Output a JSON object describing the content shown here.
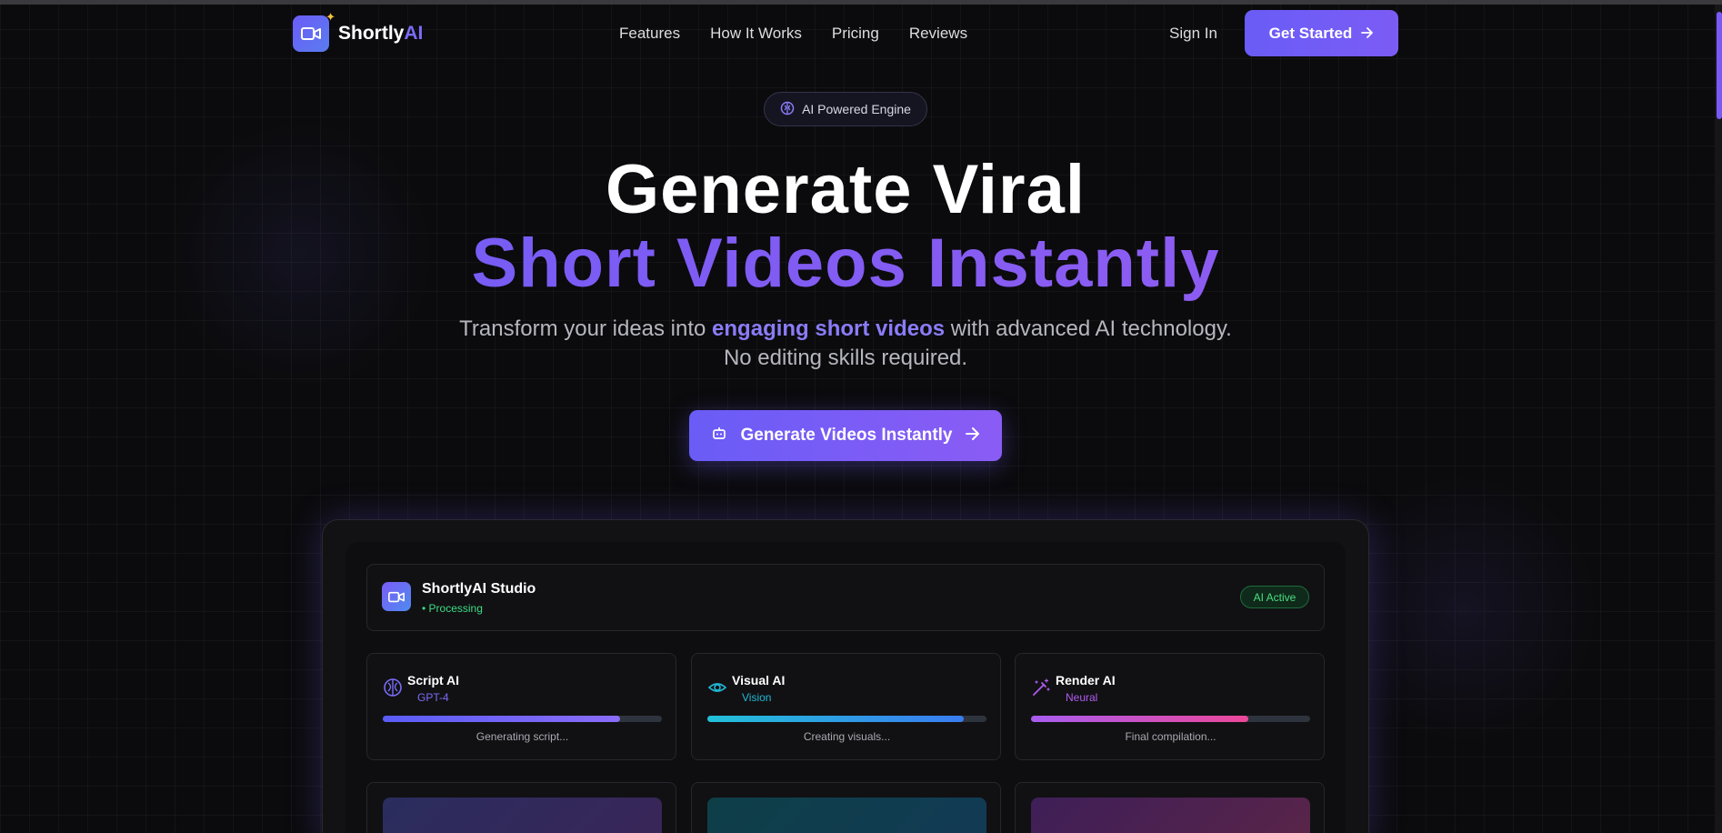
{
  "brand": {
    "name_main": "Shortly",
    "name_accent": "AI"
  },
  "nav": {
    "links": [
      "Features",
      "How It Works",
      "Pricing",
      "Reviews"
    ],
    "signin": "Sign In",
    "get_started": "Get Started"
  },
  "hero": {
    "badge": "AI Powered Engine",
    "title_line1": "Generate Viral",
    "title_line2": "Short Videos Instantly",
    "subtitle_pre": "Transform your ideas into",
    "subtitle_highlight": "engaging short videos",
    "subtitle_post": "with advanced AI technology.",
    "subtitle_line2": "No editing skills required.",
    "cta": "Generate Videos Instantly"
  },
  "studio": {
    "title": "ShortlyAI Studio",
    "status": "• Processing",
    "badge": "AI Active",
    "cards": [
      {
        "icon": "brain-icon",
        "title": "Script AI",
        "subtitle": "GPT-4",
        "progress": 0.85,
        "status": "Generating script...",
        "subtitle_color": "#7a6cf7"
      },
      {
        "icon": "eye-icon",
        "title": "Visual AI",
        "subtitle": "Vision",
        "progress": 0.92,
        "status": "Creating visuals...",
        "subtitle_color": "#22b8d6"
      },
      {
        "icon": "magic-wand-icon",
        "title": "Render AI",
        "subtitle": "Neural",
        "progress": 0.78,
        "status": "Final compilation...",
        "subtitle_color": "#b05cf0"
      }
    ]
  },
  "colors": {
    "accent": "#6a5cf6",
    "success": "#3ddc84",
    "background": "#0b0b0d"
  }
}
